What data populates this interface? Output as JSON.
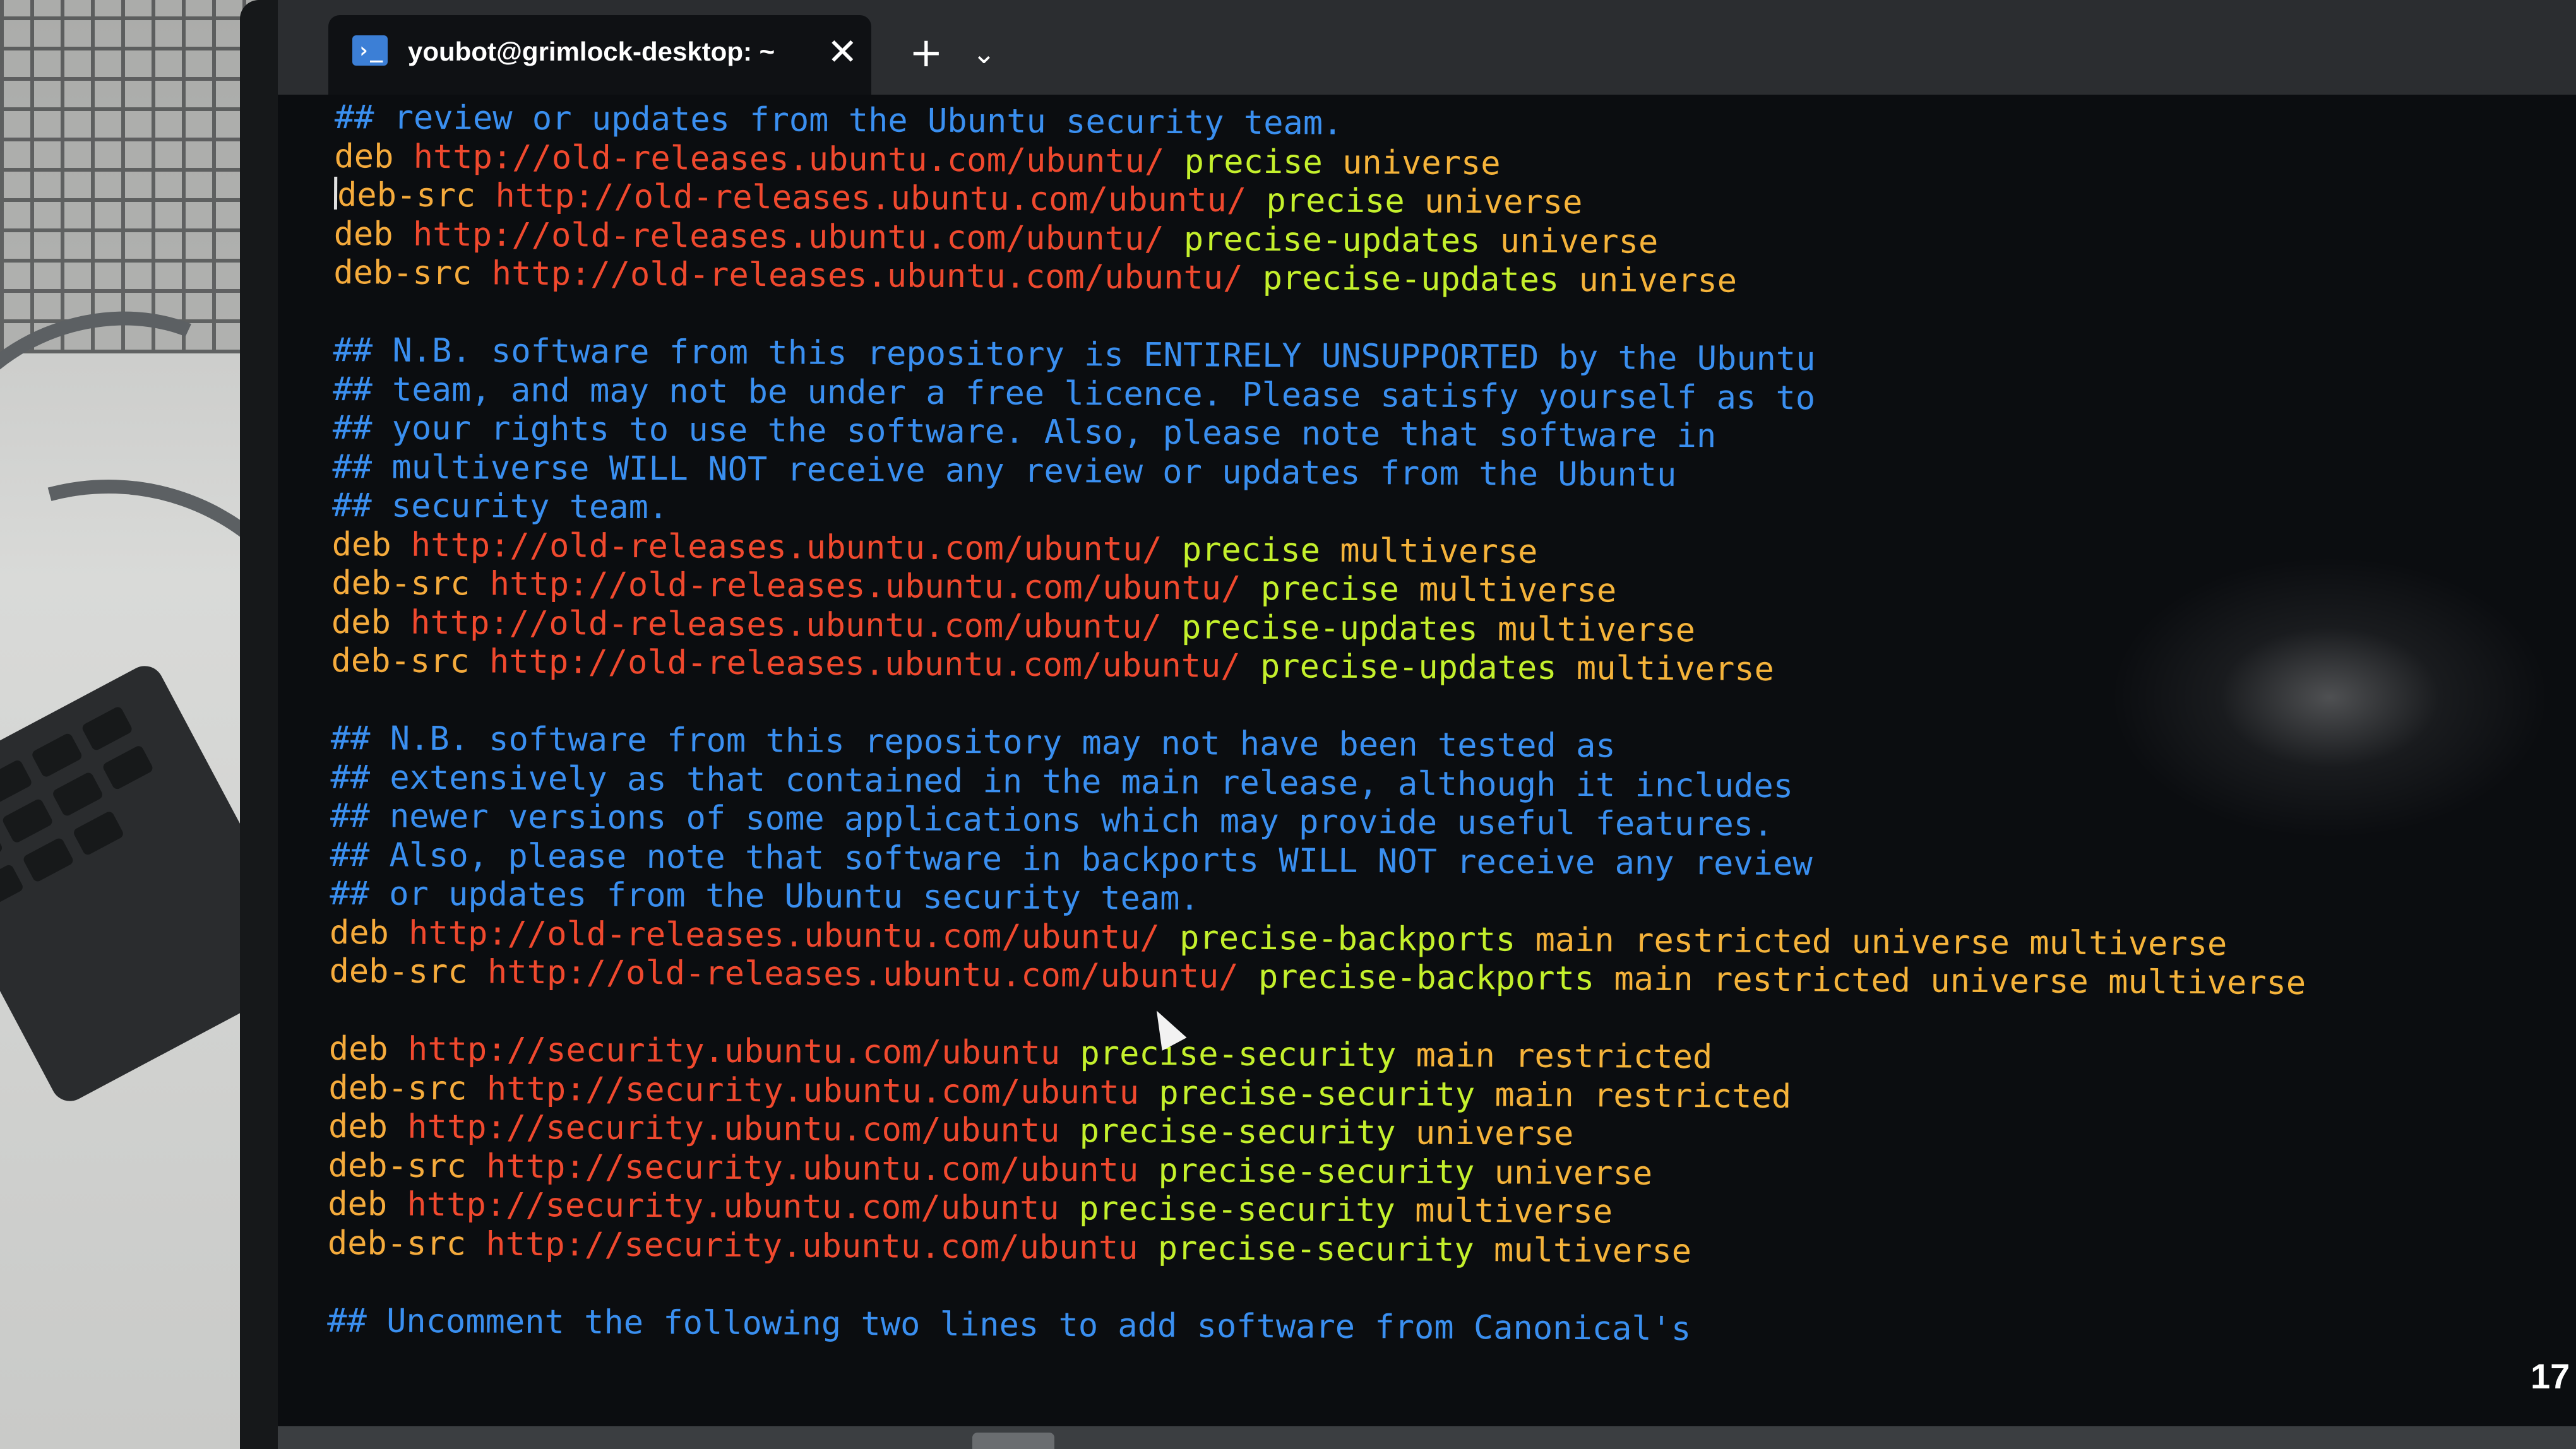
{
  "window": {
    "tab_title": "youbot@grimlock-desktop: ~",
    "tab_icon": "terminal-icon",
    "close_glyph": "✕",
    "new_tab_glyph": "+",
    "dropdown_glyph": "⌄"
  },
  "colors": {
    "background": "#0b0d10",
    "comment": "#3a8ff0",
    "keyword": "#f5ab3c",
    "url": "#f0492e",
    "distribution": "#c4f02c",
    "component": "#f5b33a"
  },
  "terminal": {
    "lines": [
      {
        "text": "## review or updates from the Ubuntu security team."
      },
      {
        "kw": "deb",
        "url": "http://old-releases.ubuntu.com/ubuntu/",
        "dist": "precise",
        "comp": "universe"
      },
      {
        "kw": "deb-src",
        "url": "http://old-releases.ubuntu.com/ubuntu/",
        "dist": "precise",
        "comp": "universe",
        "caret": true
      },
      {
        "kw": "deb",
        "url": "http://old-releases.ubuntu.com/ubuntu/",
        "dist": "precise-updates",
        "comp": "universe"
      },
      {
        "kw": "deb-src",
        "url": "http://old-releases.ubuntu.com/ubuntu/",
        "dist": "precise-updates",
        "comp": "universe"
      },
      {
        "text": ""
      },
      {
        "text": "## N.B. software from this repository is ENTIRELY UNSUPPORTED by the Ubuntu"
      },
      {
        "text": "## team, and may not be under a free licence. Please satisfy yourself as to"
      },
      {
        "text": "## your rights to use the software. Also, please note that software in"
      },
      {
        "text": "## multiverse WILL NOT receive any review or updates from the Ubuntu"
      },
      {
        "text": "## security team."
      },
      {
        "kw": "deb",
        "url": "http://old-releases.ubuntu.com/ubuntu/",
        "dist": "precise",
        "comp": "multiverse"
      },
      {
        "kw": "deb-src",
        "url": "http://old-releases.ubuntu.com/ubuntu/",
        "dist": "precise",
        "comp": "multiverse"
      },
      {
        "kw": "deb",
        "url": "http://old-releases.ubuntu.com/ubuntu/",
        "dist": "precise-updates",
        "comp": "multiverse"
      },
      {
        "kw": "deb-src",
        "url": "http://old-releases.ubuntu.com/ubuntu/",
        "dist": "precise-updates",
        "comp": "multiverse"
      },
      {
        "text": ""
      },
      {
        "text": "## N.B. software from this repository may not have been tested as"
      },
      {
        "text": "## extensively as that contained in the main release, although it includes"
      },
      {
        "text": "## newer versions of some applications which may provide useful features."
      },
      {
        "text": "## Also, please note that software in backports WILL NOT receive any review"
      },
      {
        "text": "## or updates from the Ubuntu security team."
      },
      {
        "kw": "deb",
        "url": "http://old-releases.ubuntu.com/ubuntu/",
        "dist": "precise-backports",
        "comp": "main restricted universe multiverse"
      },
      {
        "kw": "deb-src",
        "url": "http://old-releases.ubuntu.com/ubuntu/",
        "dist": "precise-backports",
        "comp": "main restricted universe multiverse"
      },
      {
        "text": ""
      },
      {
        "kw": "deb",
        "url": "http://security.ubuntu.com/ubuntu",
        "dist": "precise-security",
        "comp": "main restricted"
      },
      {
        "kw": "deb-src",
        "url": "http://security.ubuntu.com/ubuntu",
        "dist": "precise-security",
        "comp": "main restricted"
      },
      {
        "kw": "deb",
        "url": "http://security.ubuntu.com/ubuntu",
        "dist": "precise-security",
        "comp": "universe"
      },
      {
        "kw": "deb-src",
        "url": "http://security.ubuntu.com/ubuntu",
        "dist": "precise-security",
        "comp": "universe"
      },
      {
        "kw": "deb",
        "url": "http://security.ubuntu.com/ubuntu",
        "dist": "precise-security",
        "comp": "multiverse"
      },
      {
        "kw": "deb-src",
        "url": "http://security.ubuntu.com/ubuntu",
        "dist": "precise-security",
        "comp": "multiverse"
      },
      {
        "text": ""
      },
      {
        "text": "## Uncomment the following two lines to add software from Canonical's"
      }
    ]
  },
  "taskbar": {
    "clock_fragment": "17"
  }
}
